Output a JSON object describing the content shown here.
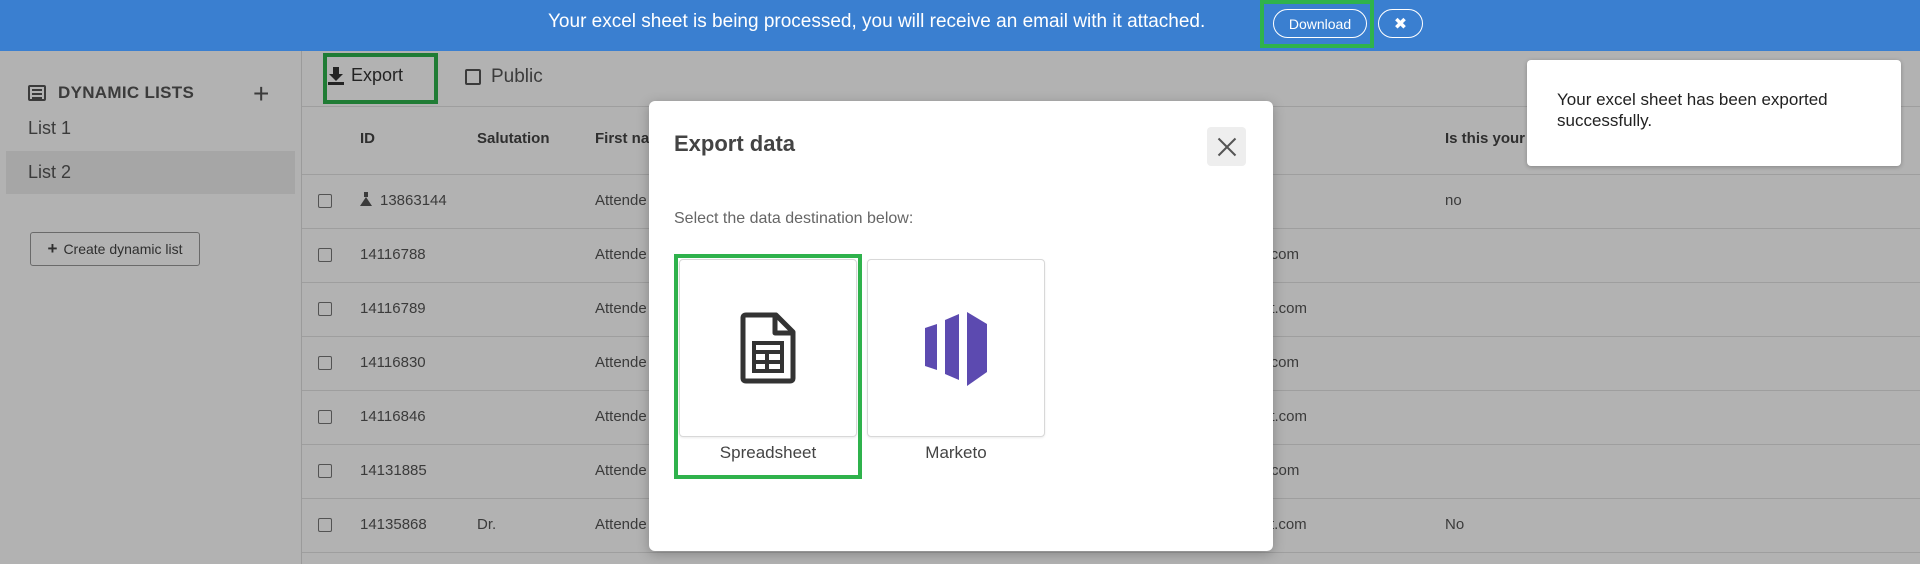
{
  "banner": {
    "message": "Your excel sheet is being processed, you will receive an email with it attached.",
    "download_label": "Download",
    "close_glyph": "✖"
  },
  "sidebar": {
    "title": "DYNAMIC LISTS",
    "add_glyph": "+",
    "items": [
      {
        "label": "List 1",
        "active": false
      },
      {
        "label": "List 2",
        "active": true
      }
    ],
    "create_glyph": "+",
    "create_label": "Create dynamic list"
  },
  "toolbar": {
    "export_label": "Export",
    "public_label": "Public"
  },
  "table": {
    "columns": [
      "ID",
      "Salutation",
      "First na",
      "Is this your f"
    ],
    "rows": [
      {
        "id": "13863144",
        "salutation": "",
        "first_name": "Attende",
        "email": "",
        "is_this": "no",
        "test": true
      },
      {
        "id": "14116788",
        "salutation": "",
        "first_name": "Attende",
        "email": "nt.com",
        "is_this": ""
      },
      {
        "id": "14116789",
        "salutation": "",
        "first_name": "Attende",
        "email": "nt.com",
        "is_this": ""
      },
      {
        "id": "14116830",
        "salutation": "",
        "first_name": "Attende",
        "email": "nt.com",
        "is_this": ""
      },
      {
        "id": "14116846",
        "salutation": "",
        "first_name": "Attende",
        "email": "nt.com",
        "is_this": ""
      },
      {
        "id": "14131885",
        "salutation": "",
        "first_name": "Attende",
        "email": "ent.com",
        "is_this": ""
      },
      {
        "id": "14135868",
        "salutation": "Dr.",
        "first_name": "Attende",
        "email": "t.com",
        "is_this": "No"
      }
    ]
  },
  "toast": {
    "message": "Your excel sheet has been exported successfully."
  },
  "modal": {
    "title": "Export data",
    "subtitle": "Select the data destination below:",
    "destinations": [
      {
        "label": "Spreadsheet",
        "icon": "spreadsheet-icon",
        "selected": true
      },
      {
        "label": "Marketo",
        "icon": "marketo-logo",
        "selected": false
      }
    ]
  },
  "colors": {
    "banner": "#3a7fd0",
    "highlight": "#2fb24c",
    "marketo": "#5c4ab0"
  }
}
